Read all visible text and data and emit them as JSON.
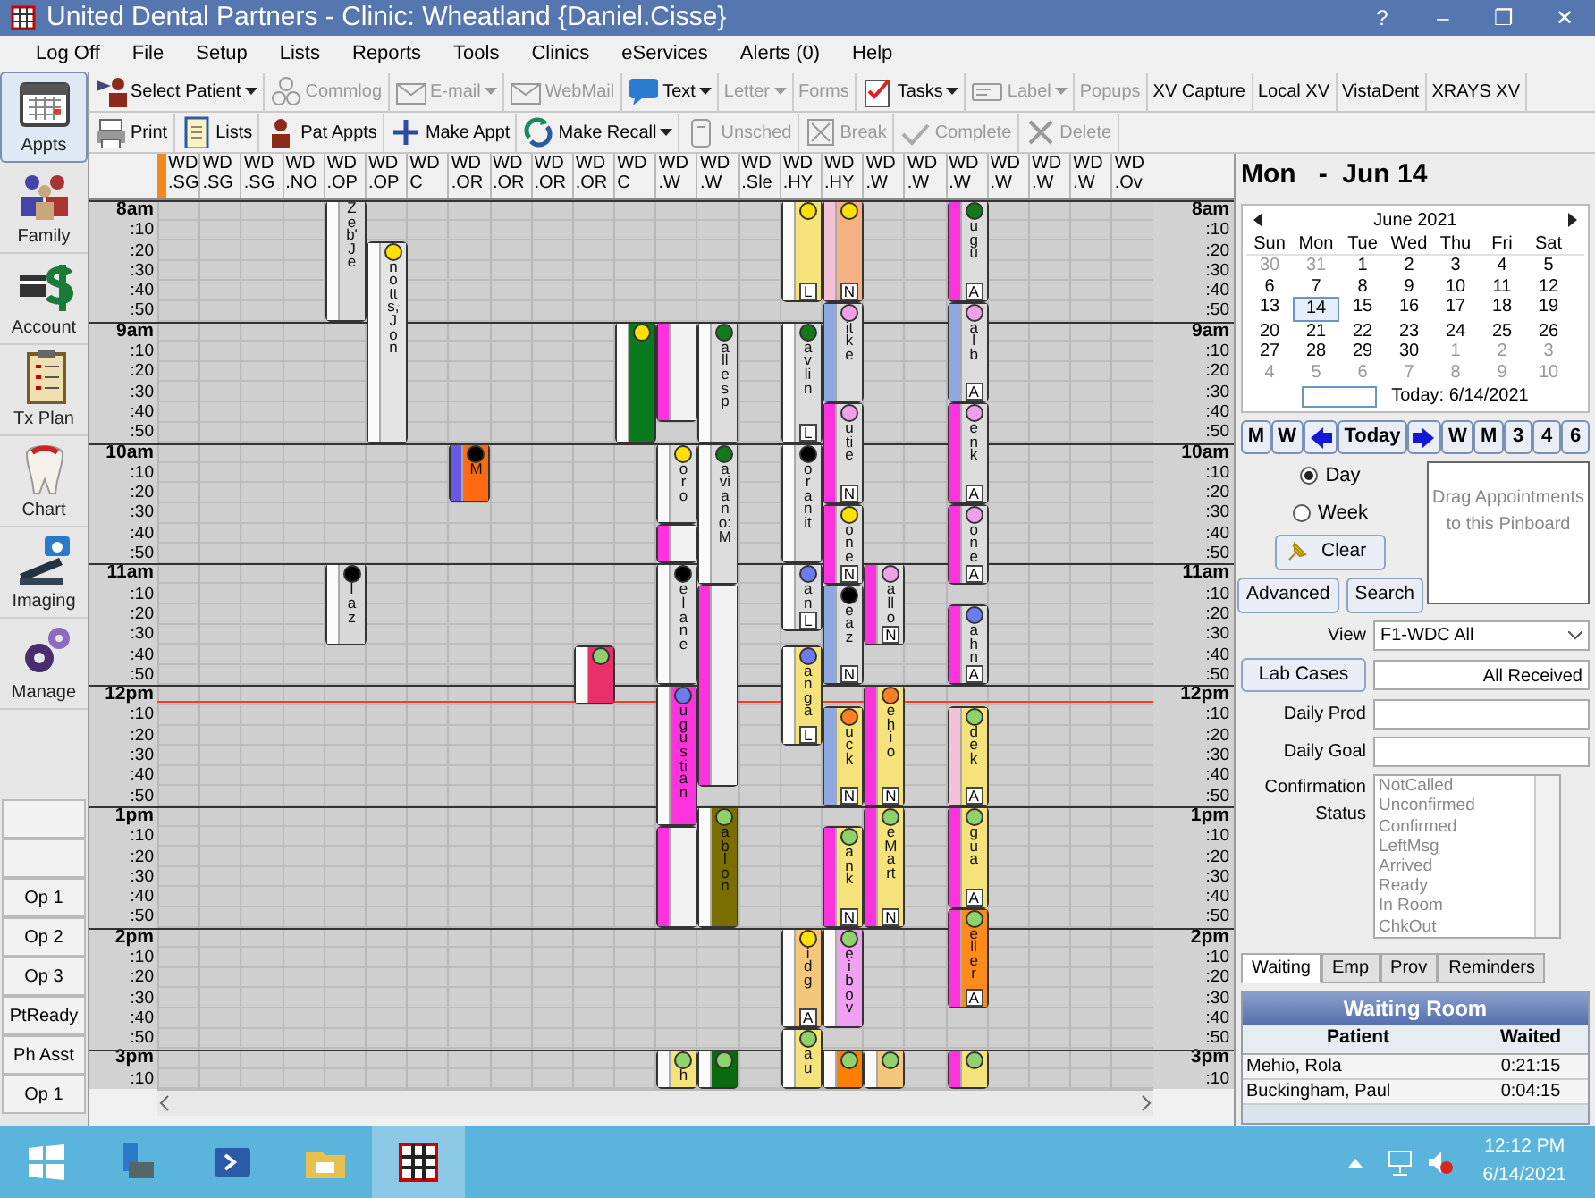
{
  "window": {
    "title": "United Dental Partners - Clinic: Wheatland {Daniel.Cisse}",
    "controls": [
      "?",
      "–",
      "❐",
      "✕"
    ]
  },
  "menu": [
    "Log Off",
    "File",
    "Setup",
    "Lists",
    "Reports",
    "Tools",
    "Clinics",
    "eServices",
    "Alerts (0)",
    "Help"
  ],
  "modules": [
    {
      "label": "Appts",
      "selected": true
    },
    {
      "label": "Family",
      "selected": false
    },
    {
      "label": "Account",
      "selected": false
    },
    {
      "label": "Tx Plan",
      "selected": false
    },
    {
      "label": "Chart",
      "selected": false
    },
    {
      "label": "Imaging",
      "selected": false
    },
    {
      "label": "Manage",
      "selected": false
    }
  ],
  "ops": [
    "Op 1",
    "Op 2",
    "Op 3",
    "PtReady",
    "Ph Asst",
    "Op 1"
  ],
  "toolbar_1": [
    {
      "label": "Select Patient",
      "dropdown": true,
      "disabled": false
    },
    {
      "label": "Commlog",
      "dropdown": false,
      "disabled": true
    },
    {
      "label": "E-mail",
      "dropdown": true,
      "disabled": true
    },
    {
      "label": "WebMail",
      "dropdown": false,
      "disabled": true
    },
    {
      "label": "Text",
      "dropdown": true,
      "disabled": false
    },
    {
      "label": "Letter",
      "dropdown": true,
      "disabled": true
    },
    {
      "label": "Forms",
      "dropdown": false,
      "disabled": true
    },
    {
      "label": "Tasks",
      "dropdown": true,
      "disabled": false
    },
    {
      "label": "Label",
      "dropdown": true,
      "disabled": true
    },
    {
      "label": "Popups",
      "dropdown": false,
      "disabled": true
    },
    {
      "label": "XV Capture",
      "dropdown": false,
      "disabled": false
    },
    {
      "label": "Local XV",
      "dropdown": false,
      "disabled": false
    },
    {
      "label": "VistaDent",
      "dropdown": false,
      "disabled": false
    },
    {
      "label": "XRAYS XV",
      "dropdown": false,
      "disabled": false
    }
  ],
  "toolbar_2": [
    {
      "label": "Print",
      "dropdown": false,
      "disabled": false
    },
    {
      "label": "Lists",
      "dropdown": false,
      "disabled": false
    },
    {
      "label": "Pat Appts",
      "dropdown": false,
      "disabled": false
    },
    {
      "label": "Make Appt",
      "dropdown": false,
      "disabled": false
    },
    {
      "label": "Make Recall",
      "dropdown": true,
      "disabled": false
    },
    {
      "label": "Unsched",
      "dropdown": false,
      "disabled": true
    },
    {
      "label": "Break",
      "dropdown": false,
      "disabled": true
    },
    {
      "label": "Complete",
      "dropdown": false,
      "disabled": true
    },
    {
      "label": "Delete",
      "dropdown": false,
      "disabled": true
    }
  ],
  "schedule": {
    "time_labels_left": [
      "8am",
      ":10",
      ":20",
      ":30",
      ":40",
      ":50",
      "9am",
      ":10",
      ":20",
      ":30",
      ":40",
      ":50",
      "10am",
      ":10",
      ":20",
      ":30",
      ":40",
      ":50",
      "11am",
      ":10",
      ":20",
      ":30",
      ":40",
      ":50",
      "12pm",
      ":10",
      ":20",
      ":30",
      ":40",
      ":50",
      "1pm",
      ":10",
      ":20",
      ":30",
      ":40",
      ":50",
      "2pm",
      ":10",
      ":20",
      ":30",
      ":40",
      ":50",
      "3pm",
      ":10"
    ],
    "time_labels_right": [
      "8am",
      ":10",
      ":20",
      ":30",
      ":40",
      ":50",
      "9am",
      ":10",
      ":20",
      ":30",
      ":40",
      ":50",
      "10am",
      ":10",
      ":20",
      ":30",
      ":40",
      ":50",
      "11am",
      ":10",
      ":20",
      ":30",
      ":40",
      ":50",
      "12pm",
      ":10",
      ":20",
      ":30",
      ":40",
      ":50",
      "1pm",
      ":10",
      ":20",
      ":30",
      ":40",
      ":50",
      "2pm",
      ":10",
      ":20",
      ":30",
      ":40",
      ":50",
      "3pm",
      ":10"
    ],
    "columns": [
      {
        "line_1": "WD",
        "line_2": ".SG"
      },
      {
        "line_1": "WD",
        "line_2": ".SG"
      },
      {
        "line_1": "WD",
        "line_2": ".SG"
      },
      {
        "line_1": "WD",
        "line_2": ".NO"
      },
      {
        "line_1": "WD",
        "line_2": ".OP",
        "appointments": [
          {
            "color": "#d8d8d8",
            "stripe": {
              "color": "#fafafa"
            },
            "text": "Zeb' Je"
          },
          {
            "color": "#d8d8d8",
            "stripe": {
              "color": "#fafafa"
            },
            "status": {
              "color": "#000000"
            },
            "text": "laz"
          }
        ]
      },
      {
        "line_1": "WD",
        "line_2": ".OP",
        "appointments": [
          {
            "color": "#e4e4e4",
            "stripe": {
              "color": "#fafafa"
            },
            "status": {
              "color": "#ffe000"
            },
            "text": "notts, Jon"
          }
        ]
      },
      {
        "line_1": "WD",
        "line_2": "C"
      },
      {
        "line_1": "WD",
        "line_2": ".OR",
        "appointments": [
          {
            "color": "#ff6a13",
            "stripe": {
              "color": "#6a5ae0"
            },
            "status": {
              "color": "#000000"
            },
            "text": "M"
          }
        ]
      },
      {
        "line_1": "WD",
        "line_2": ".OR"
      },
      {
        "line_1": "WD",
        "line_2": ".OR"
      },
      {
        "line_1": "WD",
        "line_2": ".OR",
        "appointments": [
          {
            "color": "#e8306a",
            "stripe": {
              "color": "#fafafa"
            },
            "status": {
              "color": "#8fd16a"
            }
          }
        ]
      },
      {
        "line_1": "WD",
        "line_2": "C",
        "appointments": [
          {
            "color": "#0a7a1f",
            "stripe": {
              "color": "#fafafa"
            },
            "status": {
              "color": "#ffe000"
            }
          }
        ]
      },
      {
        "line_1": "WD",
        "line_2": ".W",
        "appointments": [
          {
            "color": "#f2f2f2",
            "stripe": {
              "color": "#ff33dd"
            }
          },
          {
            "color": "#dcdcdc",
            "stripe": {
              "color": "#fafafa"
            },
            "status": {
              "color": "#ffe000"
            },
            "text": "oro"
          },
          {
            "color": "#f2f2f2",
            "stripe": {
              "color": "#ff33dd"
            }
          },
          {
            "color": "#dcdcdc",
            "stripe": {
              "color": "#fafafa"
            },
            "status": {
              "color": "#000000"
            },
            "text": "elane"
          },
          {
            "color": "#ff33dd",
            "stripe": {
              "color": "#fafafa"
            },
            "status": {
              "color": "#6e7bf0"
            },
            "text": "ugustian"
          },
          {
            "color": "#f2f2f2",
            "stripe": {
              "color": "#ff33dd"
            }
          },
          {
            "color": "#f5e27a",
            "stripe": {
              "color": "#fafafa"
            },
            "status": {
              "color": "#8fd16a"
            },
            "text": "h"
          }
        ]
      },
      {
        "line_1": "WD",
        "line_2": ".W",
        "appointments": [
          {
            "color": "#dcdcdc",
            "stripe": {
              "color": "#fafafa"
            },
            "status": {
              "color": "#127a1a"
            },
            "text": "allesp"
          },
          {
            "color": "#dcdcdc",
            "stripe": {
              "color": "#fafafa"
            },
            "status": {
              "color": "#127a1a"
            },
            "text": "aviano:M"
          },
          {
            "color": "#f2f2f2",
            "stripe": {
              "color": "#ff33dd"
            }
          },
          {
            "color": "#7a6e00",
            "stripe": {
              "color": "#fafafa"
            },
            "status": {
              "color": "#8fd16a"
            },
            "text": "ablon"
          },
          {
            "color": "#0a6a10",
            "stripe": {
              "color": "#fafafa"
            },
            "status": {
              "color": "#8fd16a"
            }
          }
        ]
      },
      {
        "line_1": "WD",
        "line_2": ".Sle"
      },
      {
        "line_1": "WD",
        "line_2": ".HY",
        "appointments": [
          {
            "color": "#f5e27a",
            "stripe": {
              "color": "#fafafa"
            },
            "status": {
              "color": "#ffe000"
            },
            "tag": "L"
          },
          {
            "color": "#dcdcdc",
            "stripe": {
              "color": "#fafafa"
            },
            "status": {
              "color": "#127a1a"
            },
            "text": "avlin",
            "tag": "L"
          },
          {
            "color": "#dcdcdc",
            "stripe": {
              "color": "#fafafa"
            },
            "status": {
              "color": "#000000"
            },
            "text": "oranit"
          },
          {
            "color": "#dcdcdc",
            "stripe": {
              "color": "#fafafa"
            },
            "status": {
              "color": "#6e7bf0"
            },
            "text": "an",
            "tag": "L"
          },
          {
            "color": "#f5e27a",
            "stripe": {
              "color": "#fafafa"
            },
            "status": {
              "color": "#6e7bf0"
            },
            "text": "anga",
            "tag": "L"
          },
          {
            "color": "#f5c77a",
            "stripe": {
              "color": "#fafafa"
            },
            "status": {
              "color": "#ffe000"
            },
            "text": "idg",
            "tag": "A"
          },
          {
            "color": "#f5e27a",
            "stripe": {
              "color": "#fafafa"
            },
            "status": {
              "color": "#8fd16a"
            },
            "text": "au"
          }
        ]
      },
      {
        "line_1": "WD",
        "line_2": ".HY",
        "appointments": [
          {
            "color": "#f4b183",
            "stripe": {
              "color": "#f4c2d8"
            },
            "status": {
              "color": "#ffe000"
            },
            "tag": "N"
          },
          {
            "color": "#dcdcdc",
            "stripe": {
              "color": "#8fa8e0"
            },
            "status": {
              "color": "#f0a0e8"
            },
            "text": "itke"
          },
          {
            "color": "#dcdcdc",
            "stripe": {
              "color": "#ff33dd"
            },
            "status": {
              "color": "#f0a0e8"
            },
            "text": "utie",
            "tag": "N"
          },
          {
            "color": "#dcdcdc",
            "stripe": {
              "color": "#ff33dd"
            },
            "status": {
              "color": "#ffe000"
            },
            "text": "one",
            "tag": "N"
          },
          {
            "color": "#dcdcdc",
            "stripe": {
              "color": "#8fa8e0"
            },
            "status": {
              "color": "#000000"
            },
            "text": "eaz",
            "tag": "N"
          },
          {
            "color": "#f5e27a",
            "stripe": {
              "color": "#8fa8e0"
            },
            "status": {
              "color": "#ff7f27"
            },
            "text": "uck",
            "tag": "N"
          },
          {
            "color": "#f5e27a",
            "stripe": {
              "color": "#ff33dd"
            },
            "status": {
              "color": "#8fd16a"
            },
            "text": "ank",
            "tag": "N"
          },
          {
            "color": "#f0a0f0",
            "stripe": {
              "color": "#fafafa"
            },
            "status": {
              "color": "#8fd16a"
            },
            "text": "eibov"
          },
          {
            "color": "#ff7f00",
            "stripe": {
              "color": "#fafafa"
            },
            "status": {
              "color": "#8fd16a"
            }
          }
        ]
      },
      {
        "line_1": "WD",
        "line_2": ".W",
        "appointments": [
          {
            "color": "#dcdcdc",
            "stripe": {
              "color": "#ff33dd"
            },
            "status": {
              "color": "#f0a0e8"
            },
            "text": "allo",
            "tag": "N"
          },
          {
            "color": "#f5e27a",
            "stripe": {
              "color": "#ff33dd"
            },
            "status": {
              "color": "#ff7f27"
            },
            "text": "ehio",
            "tag": "N"
          },
          {
            "color": "#f5e27a",
            "stripe": {
              "color": "#ff33dd"
            },
            "status": {
              "color": "#8fd16a"
            },
            "text": "eMart",
            "tag": "N"
          },
          {
            "color": "#f5c77a",
            "stripe": {
              "color": "#fafafa"
            },
            "status": {
              "color": "#8fd16a"
            }
          }
        ]
      },
      {
        "line_1": "WD",
        "line_2": ".W"
      },
      {
        "line_1": "WD",
        "line_2": ".W",
        "appointments": [
          {
            "color": "#dcdcdc",
            "stripe": {
              "color": "#ff33dd"
            },
            "status": {
              "color": "#127a1a"
            },
            "text": "ugu",
            "tag": "A"
          },
          {
            "color": "#dcdcdc",
            "stripe": {
              "color": "#8fa8e0"
            },
            "status": {
              "color": "#f0a0e8"
            },
            "text": "alb",
            "tag": "A"
          },
          {
            "color": "#dcdcdc",
            "stripe": {
              "color": "#ff33dd"
            },
            "status": {
              "color": "#f0a0e8"
            },
            "text": "enk",
            "tag": "A"
          },
          {
            "color": "#dcdcdc",
            "stripe": {
              "color": "#ff33dd"
            },
            "status": {
              "color": "#f0a0e8"
            },
            "text": "one",
            "tag": "A"
          },
          {
            "color": "#dcdcdc",
            "stripe": {
              "color": "#ff33dd"
            },
            "status": {
              "color": "#6e7bf0"
            },
            "text": "ahn",
            "tag": "A"
          },
          {
            "color": "#f5e27a",
            "stripe": {
              "color": "#f4c2d8"
            },
            "status": {
              "color": "#8fd16a"
            },
            "text": "dek",
            "tag": "A"
          },
          {
            "color": "#f5e27a",
            "stripe": {
              "color": "#ff33dd"
            },
            "status": {
              "color": "#8fd16a"
            },
            "text": "gua",
            "tag": "A"
          },
          {
            "color": "#ff8c1a",
            "stripe": {
              "color": "#ff33dd"
            },
            "status": {
              "color": "#8fd16a"
            },
            "text": "eller",
            "tag": "A"
          },
          {
            "color": "#f5e27a",
            "stripe": {
              "color": "#ff33dd"
            },
            "status": {
              "color": "#8fd16a"
            }
          }
        ]
      },
      {
        "line_1": "WD",
        "line_2": ".W"
      },
      {
        "line_1": "WD",
        "line_2": ".W"
      },
      {
        "line_1": "WD",
        "line_2": ".W"
      },
      {
        "line_1": "WD",
        "line_2": ".Ov"
      }
    ]
  },
  "side_panel": {
    "date": "Mon   -  Jun 14",
    "calendar": {
      "month": "June 2021",
      "weekdays": [
        "Sun",
        "Mon",
        "Tue",
        "Wed",
        "Thu",
        "Fri",
        "Sat"
      ],
      "weeks": [
        [
          {
            "day": "30",
            "muted": true,
            "selected": false
          },
          {
            "day": "31",
            "muted": true,
            "selected": false
          },
          {
            "day": "1",
            "muted": false,
            "selected": false
          },
          {
            "day": "2",
            "muted": false,
            "selected": false
          },
          {
            "day": "3",
            "muted": false,
            "selected": false
          },
          {
            "day": "4",
            "muted": false,
            "selected": false
          },
          {
            "day": "5",
            "muted": false,
            "selected": false
          }
        ],
        [
          {
            "day": "6",
            "muted": false,
            "selected": false
          },
          {
            "day": "7",
            "muted": false,
            "selected": false
          },
          {
            "day": "8",
            "muted": false,
            "selected": false
          },
          {
            "day": "9",
            "muted": false,
            "selected": false
          },
          {
            "day": "10",
            "muted": false,
            "selected": false
          },
          {
            "day": "11",
            "muted": false,
            "selected": false
          },
          {
            "day": "12",
            "muted": false,
            "selected": false
          }
        ],
        [
          {
            "day": "13",
            "muted": false,
            "selected": false
          },
          {
            "day": "14",
            "muted": false,
            "selected": true
          },
          {
            "day": "15",
            "muted": false,
            "selected": false
          },
          {
            "day": "16",
            "muted": false,
            "selected": false
          },
          {
            "day": "17",
            "muted": false,
            "selected": false
          },
          {
            "day": "18",
            "muted": false,
            "selected": false
          },
          {
            "day": "19",
            "muted": false,
            "selected": false
          }
        ],
        [
          {
            "day": "20",
            "muted": false,
            "selected": false
          },
          {
            "day": "21",
            "muted": false,
            "selected": false
          },
          {
            "day": "22",
            "muted": false,
            "selected": false
          },
          {
            "day": "23",
            "muted": false,
            "selected": false
          },
          {
            "day": "24",
            "muted": false,
            "selected": false
          },
          {
            "day": "25",
            "muted": false,
            "selected": false
          },
          {
            "day": "26",
            "muted": false,
            "selected": false
          }
        ],
        [
          {
            "day": "27",
            "muted": false,
            "selected": false
          },
          {
            "day": "28",
            "muted": false,
            "selected": false
          },
          {
            "day": "29",
            "muted": false,
            "selected": false
          },
          {
            "day": "30",
            "muted": false,
            "selected": false
          },
          {
            "day": "1",
            "muted": true,
            "selected": false
          },
          {
            "day": "2",
            "muted": true,
            "selected": false
          },
          {
            "day": "3",
            "muted": true,
            "selected": false
          }
        ],
        [
          {
            "day": "4",
            "muted": true,
            "selected": false
          },
          {
            "day": "5",
            "muted": true,
            "selected": false
          },
          {
            "day": "6",
            "muted": true,
            "selected": false
          },
          {
            "day": "7",
            "muted": true,
            "selected": false
          },
          {
            "day": "8",
            "muted": true,
            "selected": false
          },
          {
            "day": "9",
            "muted": true,
            "selected": false
          },
          {
            "day": "10",
            "muted": true,
            "selected": false
          }
        ]
      ],
      "today": "Today: 6/14/2021"
    },
    "nav_buttons": [
      {
        "label": "M",
        "kind": "text"
      },
      {
        "label": "W",
        "kind": "text"
      },
      {
        "kind": "back"
      },
      {
        "label": "Today",
        "kind": "text"
      },
      {
        "kind": "forward"
      },
      {
        "label": "W",
        "kind": "text"
      },
      {
        "label": "M",
        "kind": "text"
      },
      {
        "label": "3",
        "kind": "text"
      },
      {
        "label": "4",
        "kind": "text"
      },
      {
        "label": "6",
        "kind": "text"
      }
    ],
    "view_mode": [
      {
        "label": "Day",
        "selected": true
      },
      {
        "label": "Week",
        "selected": false
      }
    ],
    "pinboard": "Drag Appointments to this Pinboard",
    "clear": "Clear",
    "advanced": "Advanced",
    "search": "Search",
    "view_label": "View",
    "view_value": "F1-WDC All",
    "lab_cases": "Lab Cases",
    "lab_status": "All Received",
    "daily_prod_label": "Daily Prod",
    "daily_goal_label": "Daily Goal",
    "confirmation_label": "Confirmation Status",
    "confirmation_statuses": [
      "NotCalled",
      "Unconfirmed",
      "Confirmed",
      "LeftMsg",
      "Arrived",
      "Ready",
      "In Room",
      "ChkOut"
    ],
    "tabs": [
      {
        "label": "Waiting",
        "selected": true
      },
      {
        "label": "Emp",
        "selected": false
      },
      {
        "label": "Prov",
        "selected": false
      },
      {
        "label": "Reminders",
        "selected": false
      }
    ],
    "waiting_room": {
      "title": "Waiting Room",
      "columns": [
        "Patient",
        "Waited"
      ],
      "rows": [
        [
          "Mehio, Rola",
          "0:21:15"
        ],
        [
          "Buckingham, Paul",
          "0:04:15"
        ]
      ]
    }
  },
  "taskbar": {
    "time": "12:12 PM",
    "date": "6/14/2021"
  }
}
